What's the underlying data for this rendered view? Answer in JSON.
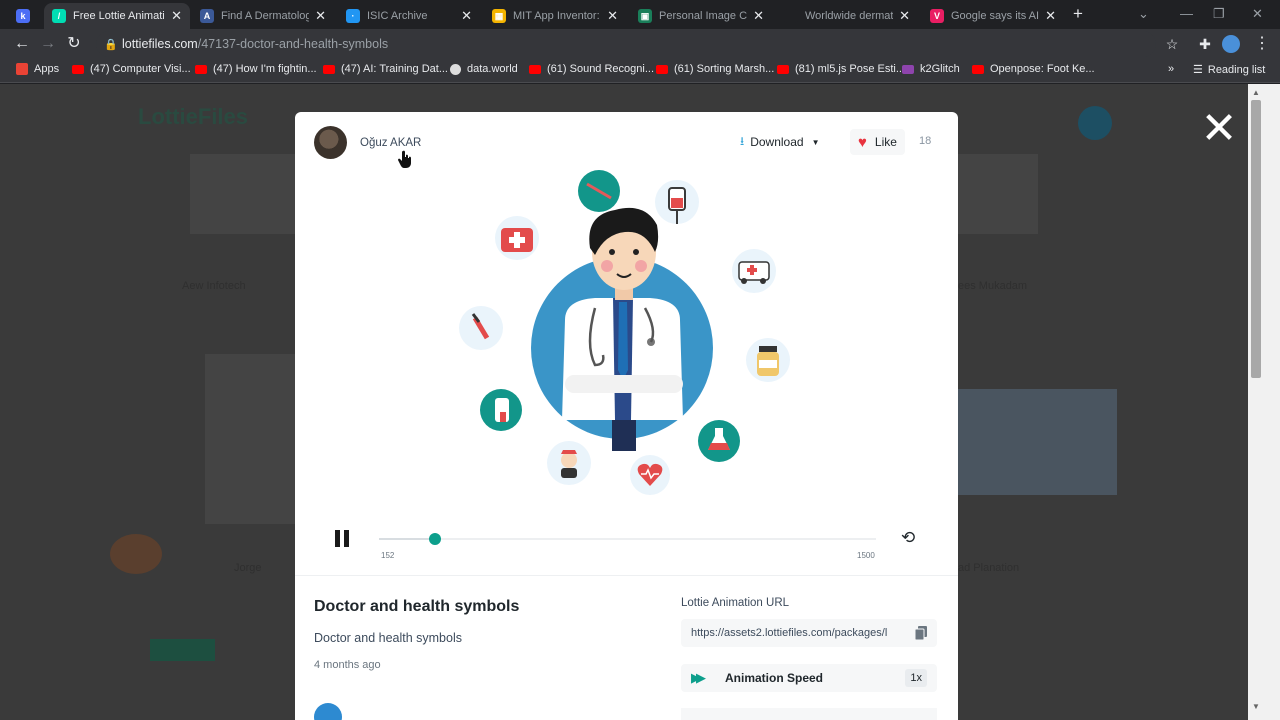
{
  "browser": {
    "tabs": [
      {
        "title": "",
        "favicon_color": "#4c6ef5",
        "favicon_letter": "k"
      },
      {
        "title": "Free Lottie Animatio",
        "favicon_color": "#00ddb3",
        "favicon_letter": "/"
      },
      {
        "title": "Find A Dermatologist",
        "favicon_color": "#3b5998",
        "favicon_letter": "A"
      },
      {
        "title": "ISIC Archive",
        "favicon_color": "#2196f3",
        "favicon_letter": "·"
      },
      {
        "title": "MIT App Inventor: C",
        "favicon_color": "#f4b400",
        "favicon_letter": "▦"
      },
      {
        "title": "Personal Image Clas",
        "favicon_color": "#1a7f5a",
        "favicon_letter": "▣"
      },
      {
        "title": "Worldwide dermato",
        "favicon_color": "#202124",
        "favicon_letter": ""
      },
      {
        "title": "Google says its AI c",
        "favicon_color": "#e91e63",
        "favicon_letter": "V"
      }
    ],
    "new_tab": "+",
    "address": {
      "domain": "lottiefiles.com",
      "path": "/47137-doctor-and-health-symbols"
    },
    "bookmarks": [
      {
        "label": "Apps",
        "color": "#ea4335"
      },
      {
        "label": "(47) Computer Visi...",
        "color": "#ff0000"
      },
      {
        "label": "(47) How I'm fightin...",
        "color": "#ff0000"
      },
      {
        "label": "(47) AI: Training Dat...",
        "color": "#ff0000"
      },
      {
        "label": "data.world",
        "color": "#dddddd"
      },
      {
        "label": "(61) Sound Recogni...",
        "color": "#ff0000"
      },
      {
        "label": "(61) Sorting Marsh...",
        "color": "#ff0000"
      },
      {
        "label": "(81) ml5.js Pose Esti...",
        "color": "#ff0000"
      },
      {
        "label": "k2Glitch",
        "color": "#8e44ad"
      },
      {
        "label": "Openpose: Foot Ke...",
        "color": "#ff0000"
      }
    ],
    "overflow": "»",
    "reading_list": "Reading list"
  },
  "background": {
    "logo": "LottieFiles",
    "texts": [
      "Aew Infotech",
      "ees Mukadam",
      "Jorge",
      "ad Planation"
    ]
  },
  "modal": {
    "author": "Oğuz AKAR",
    "download_label": "Download",
    "like_label": "Like",
    "like_count": "18",
    "player": {
      "frame_current": "152",
      "frame_total": "1500",
      "progress": 0.101
    },
    "title": "Doctor and health symbols",
    "description": "Doctor and health symbols",
    "date": "4 months ago",
    "url_label": "Lottie Animation URL",
    "url_value": "https://assets2.lottiefiles.com/packages/l",
    "speed_label": "Animation Speed",
    "speed_value": "1x"
  },
  "colors": {
    "accent": "#0d9f8c",
    "like": "#e8333f",
    "download_icon": "#33a4d8"
  }
}
